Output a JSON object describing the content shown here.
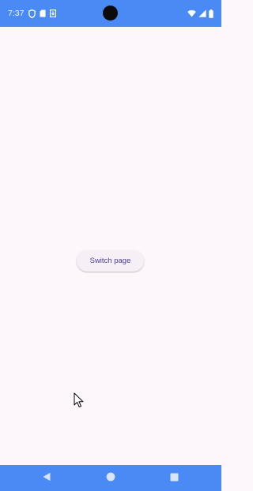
{
  "status_bar": {
    "time": "7:37",
    "left_icons": [
      "shield-icon",
      "sd-card-icon",
      "download-icon"
    ],
    "right_icons": [
      "wifi-icon",
      "signal-icon",
      "battery-icon"
    ],
    "background": "#4a8af5"
  },
  "main": {
    "switch_button_label": "Switch page",
    "background": "#fdf7fc",
    "button_text_color": "#4e3f93"
  },
  "debug_banner": {
    "color": "#c0392b"
  },
  "nav_bar": {
    "buttons": [
      "back-icon",
      "home-icon",
      "recents-icon"
    ],
    "background": "#4a8af5"
  }
}
